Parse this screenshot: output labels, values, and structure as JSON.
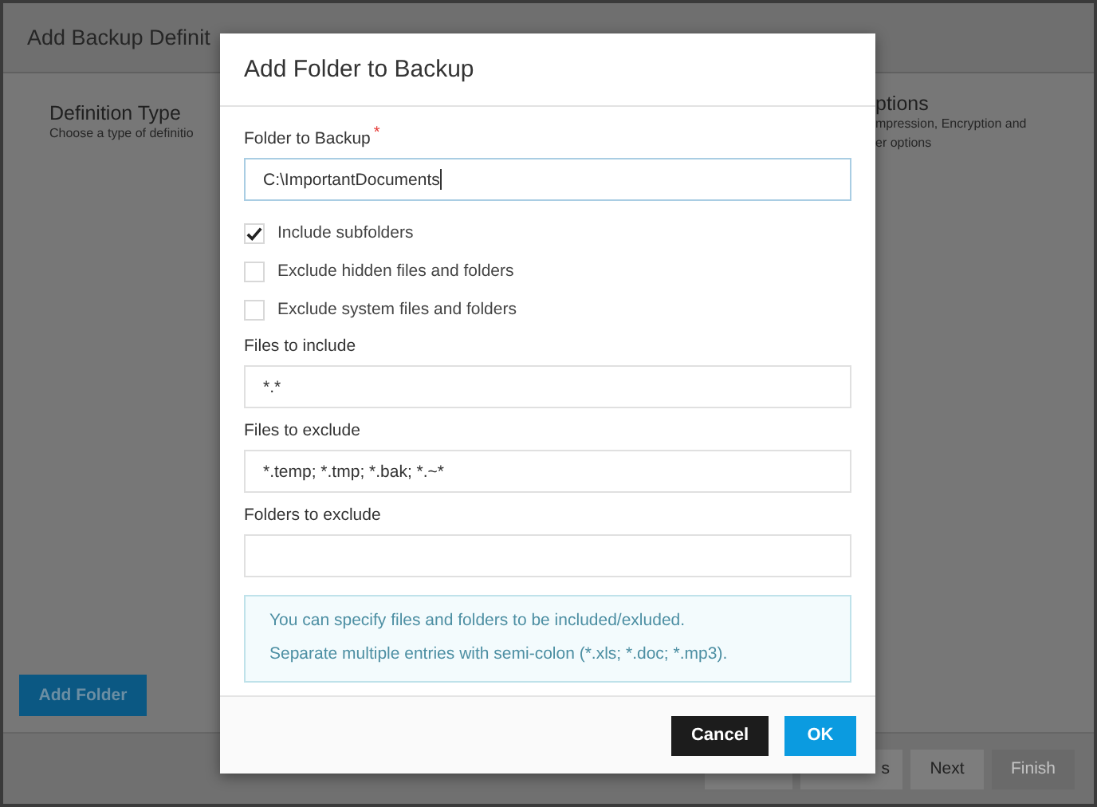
{
  "background": {
    "title": "Add Backup Definit",
    "steps": [
      {
        "title": "Definition Type",
        "lines": [
          "Choose a type of definitio"
        ]
      },
      {
        "title": "ptions",
        "lines": [
          "mpression, Encryption and",
          "er options"
        ]
      }
    ],
    "add_folder_button": "Add Folder",
    "footer_buttons": [
      {
        "disabled": false
      },
      {
        "label": "s",
        "disabled": false
      },
      {
        "label": "Next",
        "disabled": false
      },
      {
        "label": "Finish",
        "disabled": true
      }
    ]
  },
  "dialog": {
    "title": "Add Folder to Backup",
    "fields": [
      {
        "kind": "text",
        "label": "Folder to Backup",
        "required_mark": "*",
        "value": "C:\\ImportantDocuments",
        "focused": true
      },
      {
        "kind": "checkbox",
        "label": "Include subfolders",
        "checked": true
      },
      {
        "kind": "checkbox",
        "label": "Exclude hidden files and folders",
        "checked": false
      },
      {
        "kind": "checkbox",
        "label": "Exclude system files and folders",
        "checked": false
      },
      {
        "kind": "text",
        "label": "Files to include",
        "value": "*.*",
        "focused": false
      },
      {
        "kind": "text",
        "label": "Files to exclude",
        "value": "*.temp; *.tmp; *.bak; *.~*",
        "focused": false
      },
      {
        "kind": "text",
        "label": "Folders to exclude",
        "focused": false
      }
    ],
    "info": [
      "You can specify files and folders to be included/exluded.",
      "Separate multiple entries with semi-colon (*.xls; *.doc; *.mp3)."
    ],
    "buttons": [
      {
        "kind": "secondary",
        "label": "Cancel"
      },
      {
        "kind": "primary",
        "label": "OK"
      }
    ]
  }
}
